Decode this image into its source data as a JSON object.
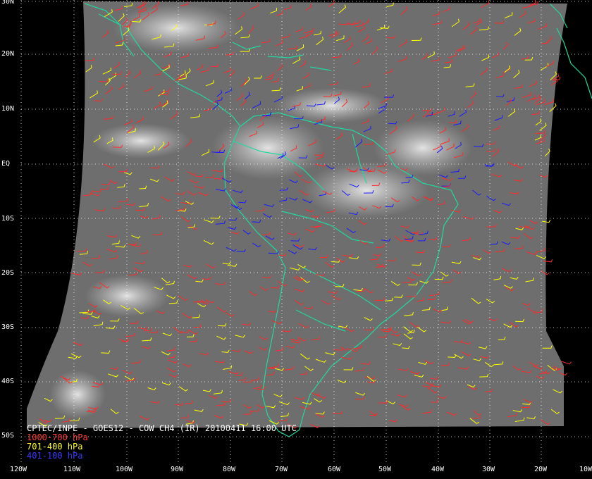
{
  "caption": {
    "title": "CPTEC/INPE - GOES12 - COW CH4 (IR) 20100411 16:00 UTC",
    "legend": [
      {
        "label": "1000-700 hPa",
        "color": "#ff2a2a"
      },
      {
        "label": "701-400 hPa",
        "color": "#ffff00"
      },
      {
        "label": "401-100 hPa",
        "color": "#1a1aff"
      }
    ]
  },
  "latitude_labels": [
    "30N",
    "20N",
    "10N",
    "EQ",
    "10S",
    "20S",
    "30S",
    "40S",
    "50S"
  ],
  "longitude_labels": [
    "120W",
    "110W",
    "100W",
    "90W",
    "80W",
    "70W",
    "60W",
    "50W",
    "40W",
    "30W",
    "20W",
    "10W"
  ],
  "colors": {
    "background": "#000000",
    "coastline": "#20d8a0",
    "grid": "#ffffff",
    "satellite_gray": "#707070"
  }
}
